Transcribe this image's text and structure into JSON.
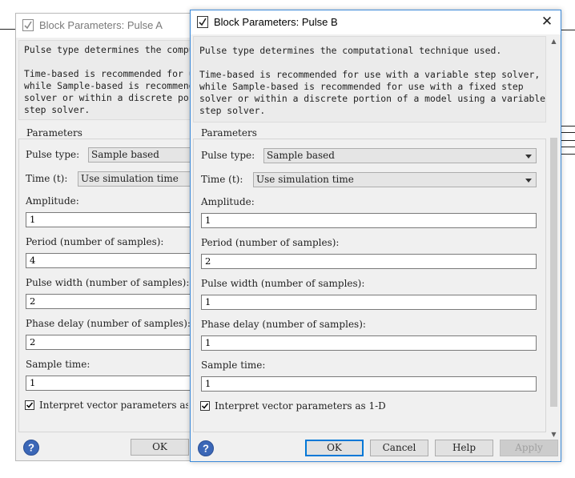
{
  "dialog_a": {
    "title": "Block Parameters: Pulse A",
    "desc_lines": [
      "Pulse type determines the computational technique used.",
      "",
      "Time-based is recommended for use with a variable step solver,",
      "while Sample-based is recommended for use with a fixed step",
      "solver or within a discrete portion of a model using a variable",
      "step solver."
    ],
    "parameters_label": "Parameters",
    "pulse_type_label": "Pulse type:",
    "pulse_type_value": "Sample based",
    "time_label": "Time (t):",
    "time_value": "Use simulation time",
    "amplitude_label": "Amplitude:",
    "amplitude_value": "1",
    "period_label": "Period (number of samples):",
    "period_value": "4",
    "pulse_width_label": "Pulse width (number of samples):",
    "pulse_width_value": "2",
    "phase_delay_label": "Phase delay (number of samples):",
    "phase_delay_value": "2",
    "sample_time_label": "Sample time:",
    "sample_time_value": "1",
    "interpret_label": "Interpret vector parameters as 1-D",
    "ok_label": "OK"
  },
  "dialog_b": {
    "title": "Block Parameters: Pulse B",
    "close_glyph": "✕",
    "desc_lines": [
      "Pulse type determines the computational technique used.",
      "",
      "Time-based is recommended for use with a variable step solver,",
      "while Sample-based is recommended for use with a fixed step",
      "solver or within a discrete portion of a model using a variable",
      "step solver."
    ],
    "parameters_label": "Parameters",
    "pulse_type_label": "Pulse type:",
    "pulse_type_value": "Sample based",
    "time_label": "Time (t):",
    "time_value": "Use simulation time",
    "amplitude_label": "Amplitude:",
    "amplitude_value": "1",
    "period_label": "Period (number of samples):",
    "period_value": "2",
    "pulse_width_label": "Pulse width (number of samples):",
    "pulse_width_value": "1",
    "phase_delay_label": "Phase delay (number of samples):",
    "phase_delay_value": "1",
    "sample_time_label": "Sample time:",
    "sample_time_value": "1",
    "interpret_label": "Interpret vector parameters as 1-D",
    "buttons": {
      "ok": "OK",
      "cancel": "Cancel",
      "help": "Help",
      "apply": "Apply"
    }
  },
  "colors": {
    "accent": "#0078d7",
    "window_border": "#3c8ad9",
    "help_icon": "#3b67b7"
  }
}
